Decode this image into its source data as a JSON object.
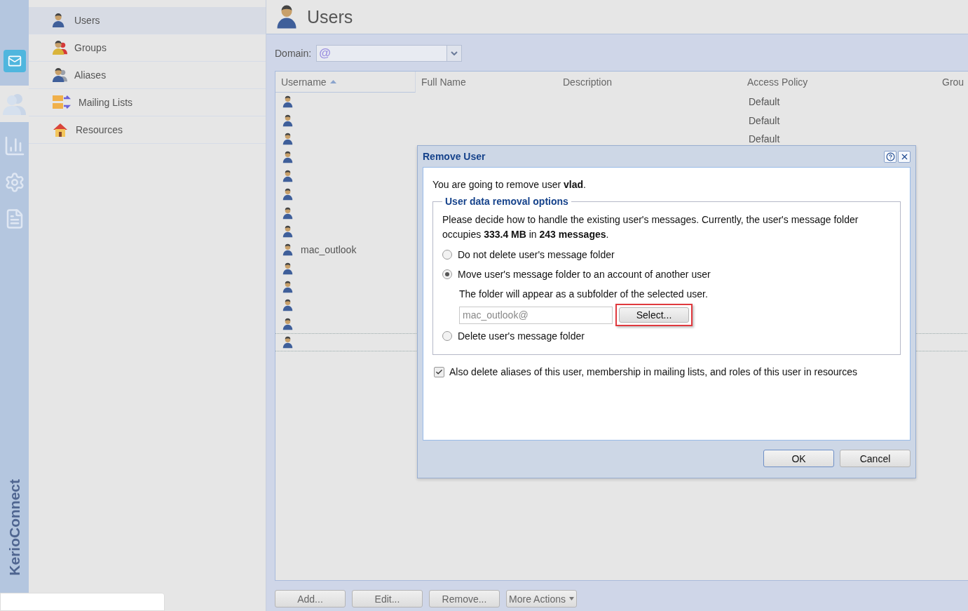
{
  "rail": {
    "items": [
      {
        "kind": "mail",
        "selected": false
      },
      {
        "kind": "users",
        "selected": true
      },
      {
        "kind": "stats",
        "selected": false
      },
      {
        "kind": "settings",
        "selected": false
      },
      {
        "kind": "logs",
        "selected": false
      }
    ],
    "brand": "KerioConnect"
  },
  "sidebar": {
    "items": [
      {
        "label": "Users",
        "kind": "user",
        "selected": true
      },
      {
        "label": "Groups",
        "kind": "group",
        "selected": false
      },
      {
        "label": "Aliases",
        "kind": "alias",
        "selected": false
      },
      {
        "label": "Mailing Lists",
        "kind": "list",
        "selected": false
      },
      {
        "label": "Resources",
        "kind": "resource",
        "selected": false
      }
    ]
  },
  "page_title": "Users",
  "domain": {
    "label": "Domain:",
    "prefix": "@"
  },
  "table": {
    "columns": [
      {
        "label": "Username",
        "sorted": true
      },
      {
        "label": "Full Name"
      },
      {
        "label": "Description"
      },
      {
        "label": "Access Policy"
      },
      {
        "label": "Grou"
      }
    ],
    "rows": [
      {
        "access_policy": "Default",
        "selected": false
      },
      {
        "access_policy": "Default",
        "selected": false
      },
      {
        "access_policy": "Default",
        "selected": false
      },
      {
        "selected": false
      },
      {
        "selected": false
      },
      {
        "selected": false
      },
      {
        "selected": false
      },
      {
        "selected": false
      },
      {
        "username": "mac_outlook",
        "selected": false
      },
      {
        "selected": false
      },
      {
        "selected": false
      },
      {
        "selected": false
      },
      {
        "selected": false
      },
      {
        "selected": true
      }
    ]
  },
  "buttons": [
    {
      "label": "Add...",
      "kind": "plain"
    },
    {
      "label": "Edit...",
      "kind": "plain"
    },
    {
      "label": "Remove...",
      "kind": "plain"
    },
    {
      "label": "More Actions",
      "kind": "menu"
    }
  ],
  "dialog": {
    "title": "Remove User",
    "intro": "You are going to remove user **vlad**.",
    "group_title": "User data removal options",
    "info": "Please decide how to handle the existing user's messages. Currently, the user's message folder occupies **333.4 MB** in **243 messages**.",
    "options": [
      {
        "label": "Do not delete user's message folder",
        "selected": false
      },
      {
        "label": "Move user's message folder to an account of another user",
        "selected": true,
        "note": "The folder will appear as a subfolder of the selected user.",
        "target": {
          "value": "mac_outlook@",
          "button": "Select...",
          "highlighted": true
        }
      },
      {
        "label": "Delete user's message folder",
        "selected": false
      }
    ],
    "also_delete": {
      "label": "Also delete aliases of this user, membership in mailing lists, and roles of this user in resources",
      "checked": true
    },
    "buttons": [
      {
        "label": "OK",
        "default": true
      },
      {
        "label": "Cancel",
        "default": false
      }
    ]
  }
}
